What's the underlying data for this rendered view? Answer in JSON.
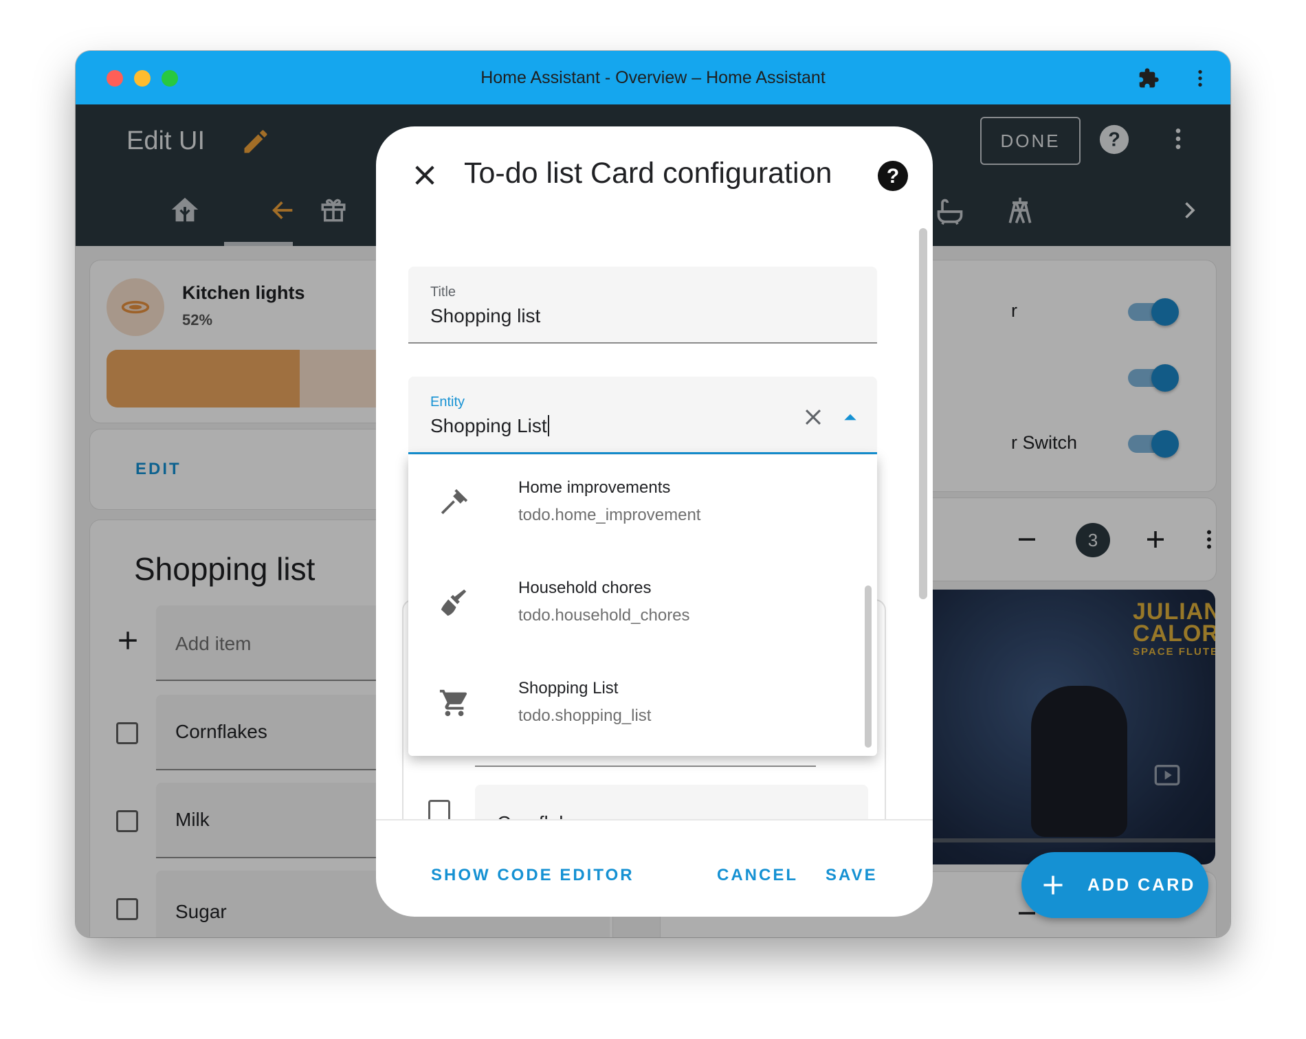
{
  "window": {
    "title": "Home Assistant - Overview – Home Assistant",
    "traffic_lights": [
      "#ff5f57",
      "#febc2e",
      "#28c840"
    ]
  },
  "header": {
    "title": "Edit UI",
    "done_label": "DONE",
    "tab_icons": [
      "home-tree-icon",
      "arrow-left-icon",
      "gift-icon",
      "bathtub-icon",
      "tower-icon",
      "chevron-right-icon"
    ]
  },
  "background": {
    "light_card": {
      "name": "Kitchen lights",
      "brightness": "52%",
      "brightness_level": 0.52,
      "edit_label": "EDIT"
    },
    "todo_card": {
      "title": "Shopping list",
      "add_placeholder": "Add item",
      "items": [
        "Cornflakes",
        "Milk",
        "Sugar"
      ]
    },
    "switches": [
      {
        "label_fragment": "r",
        "on": true
      },
      {
        "label_fragment": "",
        "on": true
      },
      {
        "label_fragment": "r Switch",
        "on": true
      }
    ],
    "counter_value": "3",
    "media_art_text": [
      "JULIAN",
      "CALOR",
      "SPACE FLUTE"
    ],
    "add_card_label": "ADD CARD"
  },
  "dialog": {
    "title": "To-do list Card configuration",
    "title_field": {
      "label": "Title",
      "value": "Shopping list"
    },
    "entity_field": {
      "label": "Entity",
      "value": "Shopping List"
    },
    "entities": [
      {
        "name": "Home improvements",
        "id": "todo.home_improvement",
        "icon": "hammer-icon"
      },
      {
        "name": "Household chores",
        "id": "todo.household_chores",
        "icon": "broom-icon"
      },
      {
        "name": "Shopping List",
        "id": "todo.shopping_list",
        "icon": "cart-icon"
      }
    ],
    "preview": {
      "first_item": "Cornflakes"
    },
    "buttons": {
      "code_editor": "SHOW CODE EDITOR",
      "cancel": "CANCEL",
      "save": "SAVE"
    }
  },
  "colors": {
    "accent": "#1591d3",
    "titlebar": "#15a6ee",
    "header": "#2c3840",
    "light_fill": "#eaa55f"
  }
}
